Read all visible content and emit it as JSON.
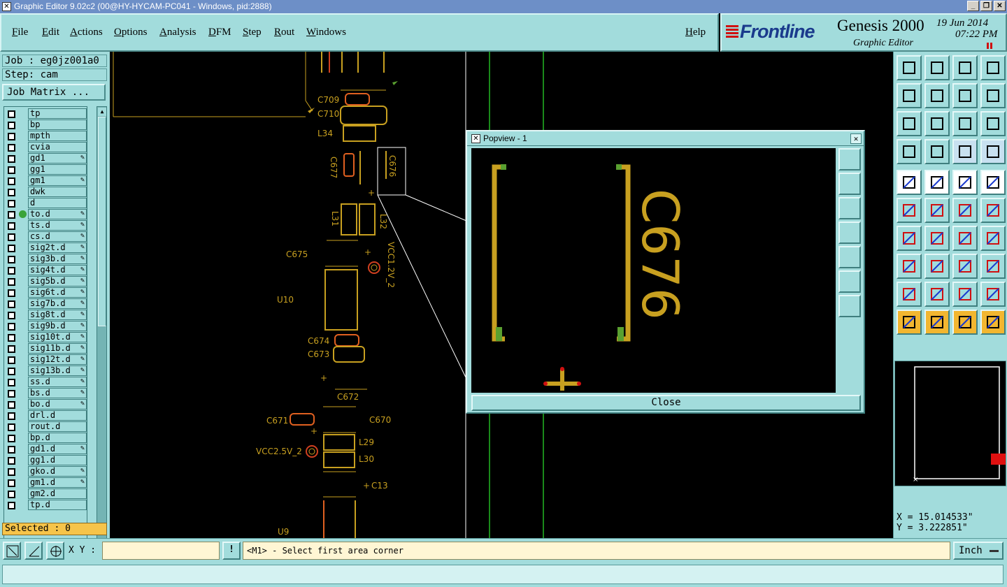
{
  "window": {
    "title": "Graphic Editor 9.02c2 (00@HY-HYCAM-PC041 - Windows, pid:2888)"
  },
  "menu": [
    "File",
    "Edit",
    "Actions",
    "Options",
    "Analysis",
    "DFM",
    "Step",
    "Rout",
    "Windows"
  ],
  "help": "Help",
  "brand": {
    "logo": "Frontline",
    "product": "Genesis 2000",
    "subtitle": "Graphic Editor",
    "date": "19 Jun 2014",
    "time": "07:22 PM"
  },
  "job": {
    "job_label": "Job : eg0jz001a0",
    "step_label": "Step: cam",
    "matrix_button": "Job Matrix ..."
  },
  "layers": [
    {
      "name": "tp",
      "edit": false
    },
    {
      "name": "bp",
      "edit": false
    },
    {
      "name": "mpth",
      "edit": false
    },
    {
      "name": "cvia",
      "edit": false
    },
    {
      "name": "gd1",
      "edit": true
    },
    {
      "name": "gg1",
      "edit": false
    },
    {
      "name": "gm1",
      "edit": true
    },
    {
      "name": "dwk",
      "edit": false
    },
    {
      "name": "d",
      "edit": false
    },
    {
      "name": "to.d",
      "edit": true,
      "active": true
    },
    {
      "name": "ts.d",
      "edit": true
    },
    {
      "name": "cs.d",
      "edit": true
    },
    {
      "name": "sig2t.d",
      "edit": true
    },
    {
      "name": "sig3b.d",
      "edit": true
    },
    {
      "name": "sig4t.d",
      "edit": true
    },
    {
      "name": "sig5b.d",
      "edit": true
    },
    {
      "name": "sig6t.d",
      "edit": true
    },
    {
      "name": "sig7b.d",
      "edit": true
    },
    {
      "name": "sig8t.d",
      "edit": true
    },
    {
      "name": "sig9b.d",
      "edit": true
    },
    {
      "name": "sig10t.d",
      "edit": true
    },
    {
      "name": "sig11b.d",
      "edit": true
    },
    {
      "name": "sig12t.d",
      "edit": true
    },
    {
      "name": "sig13b.d",
      "edit": true
    },
    {
      "name": "ss.d",
      "edit": true
    },
    {
      "name": "bs.d",
      "edit": true
    },
    {
      "name": "bo.d",
      "edit": true
    },
    {
      "name": "drl.d",
      "edit": false
    },
    {
      "name": "rout.d",
      "edit": false
    },
    {
      "name": "bp.d",
      "edit": false
    },
    {
      "name": "gd1.d",
      "edit": true
    },
    {
      "name": "gg1.d",
      "edit": false
    },
    {
      "name": "gko.d",
      "edit": true
    },
    {
      "name": "gm1.d",
      "edit": true
    },
    {
      "name": "gm2.d",
      "edit": false
    },
    {
      "name": "tp.d",
      "edit": false
    }
  ],
  "selected": "Selected : 0",
  "canvas_labels": {
    "c709": "C709",
    "c710": "C710",
    "l34": "L34",
    "c677": "C677",
    "c676": "C676",
    "l31": "L31",
    "l32": "L32",
    "c675": "C675",
    "vcc12": "VCC1.2V_2",
    "u10": "U10",
    "c674": "C674",
    "c673": "C673",
    "c672": "C672",
    "c671": "C671",
    "c670": "C670",
    "vcc25": "VCC2.5V_2",
    "l29": "L29",
    "l30": "L30",
    "c13": "C13",
    "u9": "U9"
  },
  "popview": {
    "title": "Popview - 1",
    "close_label": "Close",
    "label": "C676"
  },
  "coords": {
    "x": "X = 15.014533\"",
    "y": "Y = 3.222851\""
  },
  "command": {
    "xy_label": "X Y :",
    "xy_value": "",
    "bang": "!",
    "prompt": "<M1> - Select first area corner",
    "units": "Inch"
  },
  "colors": {
    "panel": "#a2dcdc",
    "silk": "#c8a020",
    "board_line": "#1a8a1a",
    "title_bar": "#6d8fc7"
  }
}
